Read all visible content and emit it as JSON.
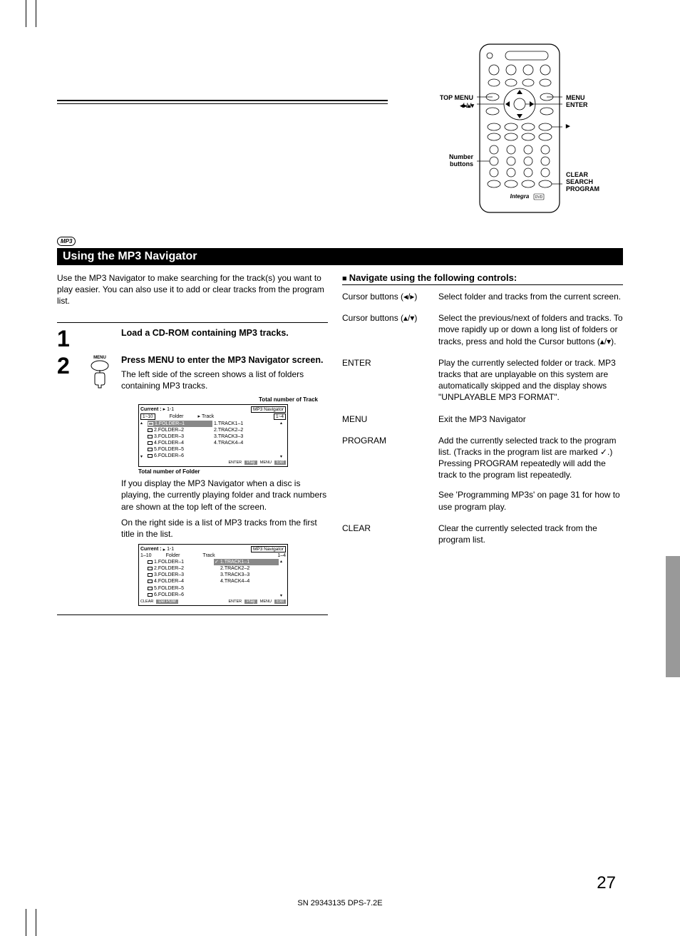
{
  "remote": {
    "label_topmenu": "TOP MENU",
    "label_arrows": "◂/▸/▴/▾",
    "label_number": "Number\nbuttons",
    "label_menu": "MENU",
    "label_enter": "ENTER",
    "label_play": "▸",
    "label_clear": "CLEAR",
    "label_search": "SEARCH",
    "label_program": "PROGRAM",
    "brand": "Integra"
  },
  "badge": "MP3",
  "section_title": "Using the MP3 Navigator",
  "intro": "Use the MP3 Navigator to make searching for the track(s) you want to play easier. You can also use it to add or clear tracks from the program list.",
  "steps": {
    "s1": {
      "num": "1",
      "title": "Load a CD-ROM containing MP3 tracks."
    },
    "s2": {
      "num": "2",
      "icon_label": "MENU",
      "title": "Press MENU to enter the MP3 Navigator screen.",
      "desc1": "The left side of the screen shows a list of folders containing MP3 tracks.",
      "caption_track": "Total number of Track",
      "caption_folder": "Total number of Folder",
      "desc2": "If you display the MP3 Navigator when a disc is playing, the currently playing folder and track numbers are shown at the top left of the screen.",
      "desc3": "On the right side is a list of MP3 tracks from the first title in the list."
    }
  },
  "navscreen": {
    "current": "Current :",
    "play_pos": "1-1",
    "title": "MP3 Navigator",
    "range_folder": "1~10",
    "hdr_folder": "Folder",
    "hdr_track": "Track",
    "range_track": "1~4",
    "range_folder2": "1–10",
    "range_track2": "1–4",
    "folders": [
      "1.FOLDER–1",
      "2.FOLDER–2",
      "3.FOLDER–3",
      "4.FOLDER–4",
      "5.FOLDER–5",
      "6.FOLDER–6"
    ],
    "tracks": [
      "1.TRACK1–1",
      "2.TRACK2–2",
      "3.TRACK3–3",
      "4.TRACK4–4"
    ],
    "btn_enter": "ENTER",
    "btn_play": "Play",
    "btn_menu": "MENU",
    "btn_exit": "Exit",
    "btn_clear": "CLEAR",
    "btn_delpgm": "Del PGM"
  },
  "controls": {
    "heading": "Navigate using the following controls:",
    "rows": [
      {
        "label": "Cursor buttons (◂/▸)",
        "desc": "Select folder and tracks from the current screen."
      },
      {
        "label": "Cursor buttons (▴/▾)",
        "desc": "Select the previous/next of folders and tracks. To move rapidly up or down a long list of folders or tracks, press and hold the Cursor buttons (▴/▾)."
      },
      {
        "label": "ENTER",
        "desc": "Play the currently selected folder or track. MP3 tracks that are unplayable on this system are automatically skipped and the display shows \"UNPLAYABLE MP3 FORMAT\"."
      },
      {
        "label": "MENU",
        "desc": "Exit the MP3 Navigator"
      },
      {
        "label": "PROGRAM",
        "desc": "Add the currently selected track to the program list. (Tracks in the program list are  marked ✓.) Pressing PROGRAM repeatedly will add the track to the program list repeatedly.",
        "desc2": "See 'Programming MP3s' on page 31 for how to use program play."
      },
      {
        "label": "CLEAR",
        "desc": "Clear the currently selected track from the program list."
      }
    ]
  },
  "page_number": "27",
  "footer_code": "SN 29343135 DPS-7.2E"
}
